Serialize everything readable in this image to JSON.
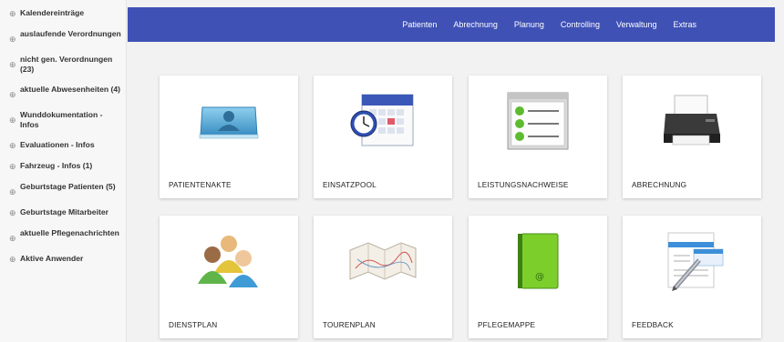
{
  "sidebar": {
    "items": [
      {
        "label": "Kalendereinträge"
      },
      {
        "label": "auslaufende Verordnungen"
      },
      {
        "label": "nicht gen. Verordnungen (23)"
      },
      {
        "label": "aktuelle Abwesenheiten (4)"
      },
      {
        "label": "Wunddokumentation - Infos"
      },
      {
        "label": "Evaluationen - Infos"
      },
      {
        "label": "Fahrzeug - Infos (1)"
      },
      {
        "label": "Geburtstage Patienten (5)"
      },
      {
        "label": "Geburtstage Mitarbeiter"
      },
      {
        "label": "aktuelle Pflegenachrichten"
      },
      {
        "label": "Aktive Anwender"
      }
    ]
  },
  "nav": {
    "items": [
      "Patienten",
      "Abrechnung",
      "Planung",
      "Controlling",
      "Verwaltung",
      "Extras"
    ],
    "color": "#3f51b5"
  },
  "tiles": [
    {
      "label": "PATIENTENAKTE",
      "icon": "patient-record-icon"
    },
    {
      "label": "EINSATZPOOL",
      "icon": "calendar-clock-icon"
    },
    {
      "label": "LEISTUNGSNACHWEISE",
      "icon": "checklist-icon"
    },
    {
      "label": "ABRECHNUNG",
      "icon": "printer-icon"
    },
    {
      "label": "DIENSTPLAN",
      "icon": "people-icon"
    },
    {
      "label": "TOURENPLAN",
      "icon": "map-icon"
    },
    {
      "label": "PFLEGEMAPPE",
      "icon": "green-folder-icon"
    },
    {
      "label": "FEEDBACK",
      "icon": "document-pencil-icon"
    }
  ]
}
